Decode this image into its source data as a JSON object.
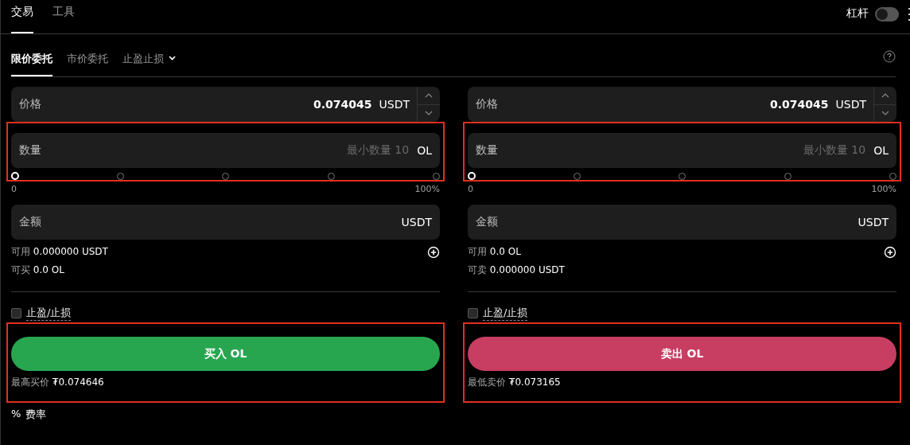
{
  "top_tabs": [
    {
      "label": "交易",
      "selected": true
    },
    {
      "label": "工具",
      "selected": false
    }
  ],
  "leverage": {
    "label": "杠杆",
    "on": false
  },
  "order_types": [
    {
      "label": "限价委托",
      "selected": true,
      "kind": "tab"
    },
    {
      "label": "市价委托",
      "selected": false,
      "kind": "tab"
    },
    {
      "label": "止盈止损",
      "selected": false,
      "kind": "dropdown"
    }
  ],
  "panels": [
    {
      "price": {
        "label": "价格",
        "value": "0.074045",
        "unit": "USDT"
      },
      "quantity": {
        "label": "数量",
        "placeholder": "最小数量 10",
        "unit": "OL",
        "highlighted": true
      },
      "slider": {
        "level": 0,
        "min_label": "0",
        "max_label": "100%"
      },
      "amount": {
        "label": "金额",
        "unit": "USDT"
      },
      "balances": [
        {
          "label": "可用",
          "value": "0.000000 USDT"
        },
        {
          "label": "可买",
          "value": "0.0 OL"
        }
      ],
      "take_profit": {
        "label": "止盈/止损",
        "checked": false
      },
      "action": {
        "label": "买入 OL",
        "kind": "buy",
        "highlighted": true
      },
      "best_price": {
        "label": "最高买价",
        "value": "₮0.074646"
      }
    },
    {
      "price": {
        "label": "价格",
        "value": "0.074045",
        "unit": "USDT"
      },
      "quantity": {
        "label": "数量",
        "placeholder": "最小数量 10",
        "unit": "OL",
        "highlighted": true
      },
      "slider": {
        "level": 0,
        "min_label": "0",
        "max_label": "100%"
      },
      "amount": {
        "label": "金额",
        "unit": "USDT"
      },
      "balances": [
        {
          "label": "可用",
          "value": "0.0 OL"
        },
        {
          "label": "可卖",
          "value": "0.000000 USDT"
        }
      ],
      "take_profit": {
        "label": "止盈/止损",
        "checked": false
      },
      "action": {
        "label": "卖出 OL",
        "kind": "sell",
        "highlighted": true
      },
      "best_price": {
        "label": "最低卖价",
        "value": "₮0.073165"
      }
    }
  ],
  "fee": {
    "symbol": "%",
    "label": "费率"
  }
}
